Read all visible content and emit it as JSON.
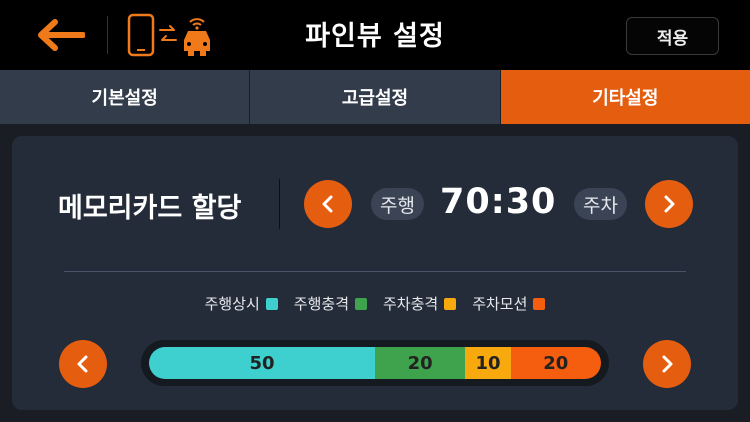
{
  "header": {
    "title": "파인뷰 설정",
    "apply_label": "적용",
    "accent": "#e55e10"
  },
  "tabs": [
    {
      "label": "기본설정",
      "active": false
    },
    {
      "label": "고급설정",
      "active": false
    },
    {
      "label": "기타설정",
      "active": true
    }
  ],
  "memory": {
    "label": "메모리카드 할당",
    "left_pill": "주행",
    "ratio": "70:30",
    "right_pill": "주차"
  },
  "legend": [
    {
      "label": "주행상시",
      "color": "#3ecfcf"
    },
    {
      "label": "주행충격",
      "color": "#3fa34d"
    },
    {
      "label": "주차충격",
      "color": "#f7a90e"
    },
    {
      "label": "주차모션",
      "color": "#f55d0f"
    }
  ],
  "allocation": [
    {
      "value": "50",
      "share": 50,
      "color": "#3ecfcf"
    },
    {
      "value": "20",
      "share": 20,
      "color": "#3fa34d"
    },
    {
      "value": "10",
      "share": 10,
      "color": "#f7a90e"
    },
    {
      "value": "20",
      "share": 20,
      "color": "#f55d0f"
    }
  ]
}
